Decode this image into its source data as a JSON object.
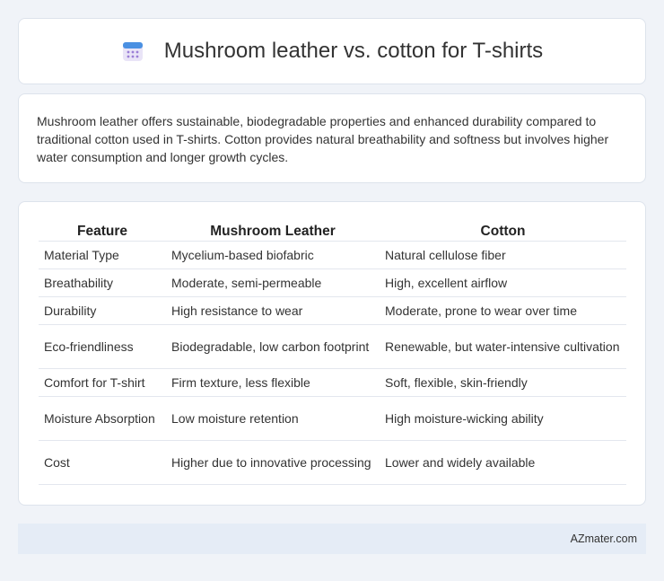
{
  "header": {
    "icon": "calendar-icon",
    "title": "Mushroom leather vs. cotton for T-shirts"
  },
  "summary": "Mushroom leather offers sustainable, biodegradable properties and enhanced durability compared to traditional cotton used in T-shirts. Cotton provides natural breathability and softness but involves higher water consumption and longer growth cycles.",
  "table": {
    "headers": [
      "Feature",
      "Mushroom Leather",
      "Cotton"
    ],
    "rows": [
      [
        "Material Type",
        "Mycelium-based biofabric",
        "Natural cellulose fiber"
      ],
      [
        "Breathability",
        "Moderate, semi-permeable",
        "High, excellent airflow"
      ],
      [
        "Durability",
        "High resistance to wear",
        "Moderate, prone to wear over time"
      ],
      [
        "Eco-friendliness",
        "Biodegradable, low carbon footprint",
        "Renewable, but water-intensive cultivation"
      ],
      [
        "Comfort for T-shirt",
        "Firm texture, less flexible",
        "Soft, flexible, skin-friendly"
      ],
      [
        "Moisture Absorption",
        "Low moisture retention",
        "High moisture-wicking ability"
      ],
      [
        "Cost",
        "Higher due to innovative processing",
        "Lower and widely available"
      ]
    ]
  },
  "footer": {
    "brand": "AZmater.com"
  },
  "colors": {
    "accent": "#4a7fd4",
    "icon_top": "#4a90e2",
    "icon_dots": "#9b7fd6"
  }
}
